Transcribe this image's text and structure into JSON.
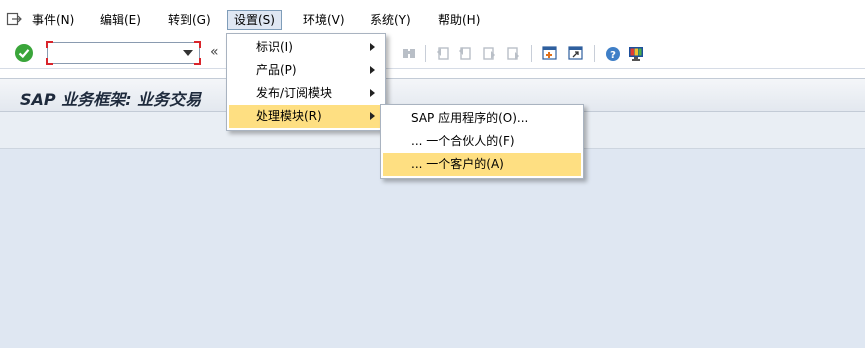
{
  "menubar": {
    "items": [
      {
        "label": "事件(N)"
      },
      {
        "label": "编辑(E)"
      },
      {
        "label": "转到(G)"
      },
      {
        "label": "设置(S)"
      },
      {
        "label": "环境(V)"
      },
      {
        "label": "系统(Y)"
      },
      {
        "label": "帮助(H)"
      }
    ]
  },
  "toolbar": {
    "command_field_value": "",
    "collapse_label": "«"
  },
  "title": {
    "text": "SAP 业务框架: 业务交易"
  },
  "settings_menu": {
    "items": [
      {
        "label": "标识(I)",
        "has_submenu": true
      },
      {
        "label": "产品(P)",
        "has_submenu": true
      },
      {
        "label": "发布/订阅模块",
        "has_submenu": true
      },
      {
        "label": "处理模块(R)",
        "has_submenu": true,
        "highlighted": true
      }
    ]
  },
  "processing_submenu": {
    "items": [
      {
        "label": "SAP 应用程序的(O)..."
      },
      {
        "label": "... 一个合伙人的(F)"
      },
      {
        "label": "... 一个客户的(A)",
        "highlighted": true
      }
    ]
  },
  "colors": {
    "menu_highlight": "#fedf82",
    "workarea": "#dfe7f2",
    "ok_green": "#3aa53a",
    "required_marker": "#d9242b"
  }
}
